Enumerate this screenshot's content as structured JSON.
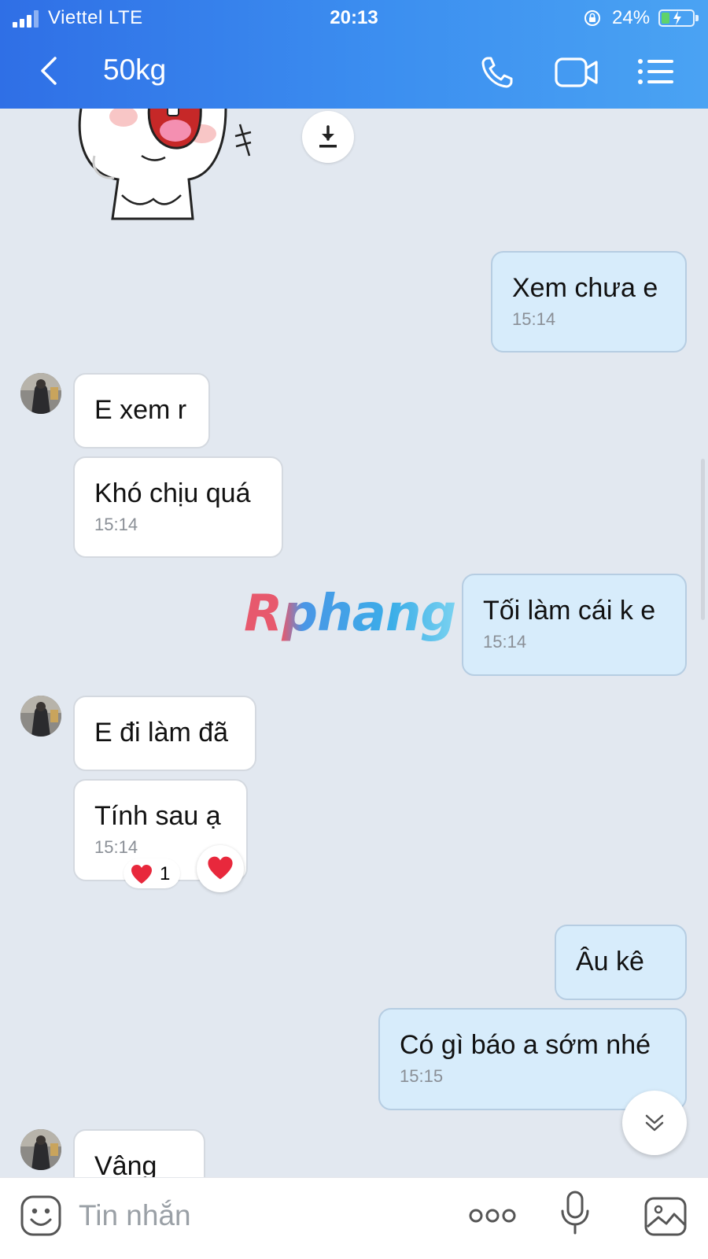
{
  "status_bar": {
    "carrier": "Viettel  LTE",
    "time": "20:13",
    "battery": "24%"
  },
  "header": {
    "title": "50kg",
    "icons": [
      "back-icon",
      "phone-icon",
      "video-call-icon",
      "menu-icon"
    ]
  },
  "messages": [
    {
      "side": "in",
      "text": "E xem r",
      "time": ""
    },
    {
      "side": "out",
      "text": "Xem chưa e",
      "time": "15:14"
    },
    {
      "side": "in",
      "text": "Khó chịu quá",
      "time": "15:14"
    },
    {
      "side": "out",
      "text": "Tối làm cái k e",
      "time": "15:14"
    },
    {
      "side": "in",
      "text": "E đi làm đã",
      "time": ""
    },
    {
      "side": "in",
      "text": "Tính sau ạ",
      "time": "15:14"
    },
    {
      "side": "out",
      "text": "Âu kê",
      "time": ""
    },
    {
      "side": "out",
      "text": "Có gì báo a sớm nhé",
      "time": "15:15"
    },
    {
      "side": "in",
      "text": "Vâng",
      "time": ""
    }
  ],
  "reaction": {
    "count": "1",
    "emoji": "heart"
  },
  "watermark": "Rphang",
  "input": {
    "placeholder": "Tin nhắn",
    "value": ""
  },
  "colors": {
    "header_start": "#2f6fe6",
    "header_end": "#4aa3f3",
    "chat_bg": "#e2e8f0",
    "incoming_bubble": "#ffffff",
    "outgoing_bubble": "#d7ecfb",
    "reaction_heart": "#e8283c"
  }
}
